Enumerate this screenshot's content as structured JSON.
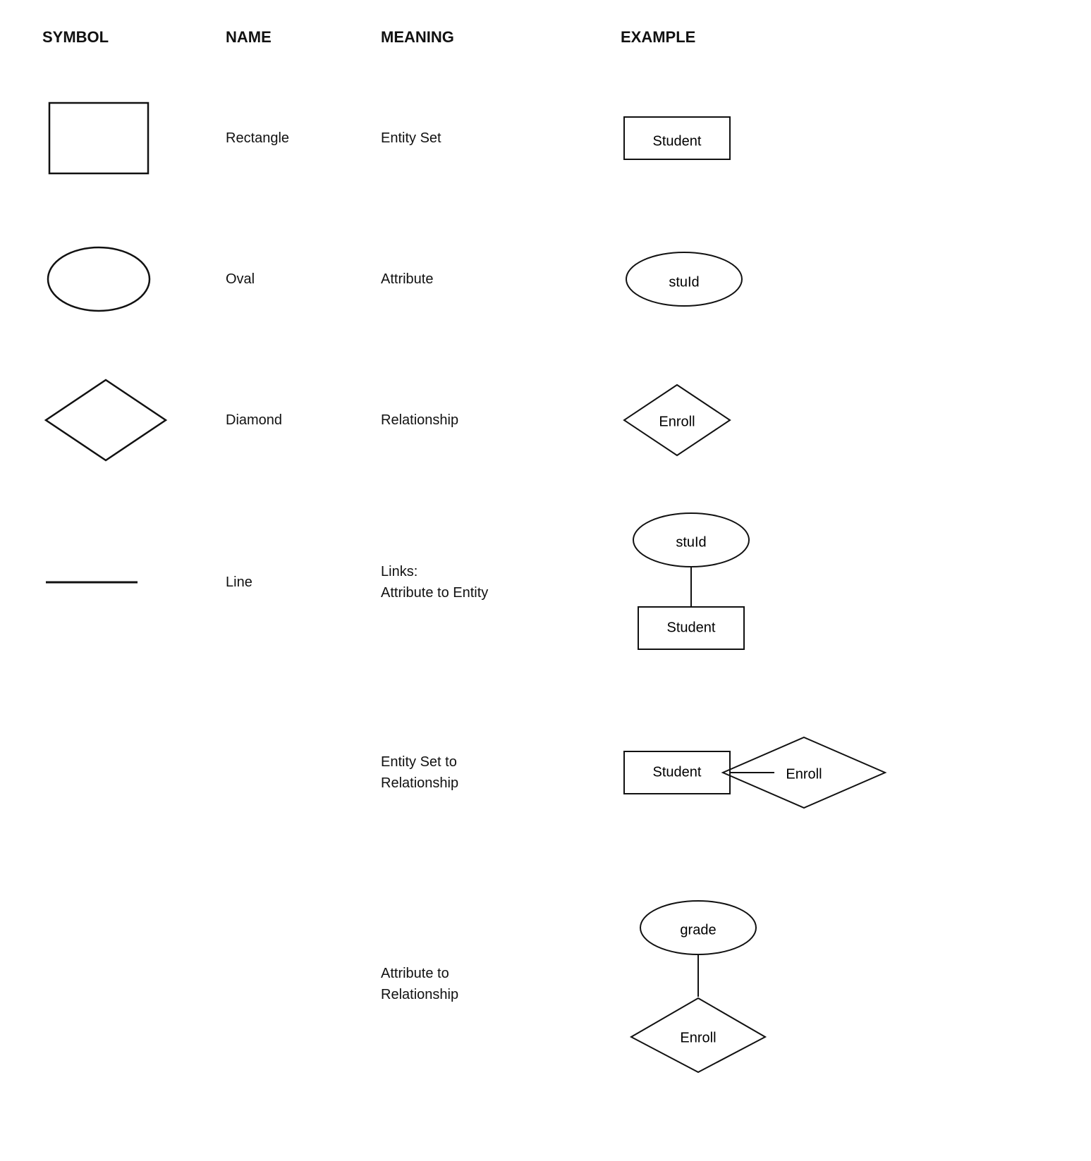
{
  "header": {
    "symbol": "SYMBOL",
    "name": "NAME",
    "meaning": "MEANING",
    "example": "EXAMPLE"
  },
  "rows": [
    {
      "id": "rectangle",
      "name": "Rectangle",
      "meaning": "Entity Set",
      "example_label": "Student"
    },
    {
      "id": "oval",
      "name": "Oval",
      "meaning": "Attribute",
      "example_label": "stuId"
    },
    {
      "id": "diamond",
      "name": "Diamond",
      "meaning": "Relationship",
      "example_label": "Enroll"
    },
    {
      "id": "line",
      "name": "Line",
      "meaning_line1": "Links:",
      "meaning_line2": "Attribute to Entity",
      "example_oval": "stuId",
      "example_rect": "Student"
    }
  ],
  "extra_rows": [
    {
      "id": "entity-set-to-relationship",
      "meaning_line1": "Entity Set to",
      "meaning_line2": "Relationship",
      "example_rect": "Student",
      "example_diamond": "Enroll"
    },
    {
      "id": "attribute-to-relationship",
      "meaning_line1": "Attribute to",
      "meaning_line2": "Relationship",
      "example_oval": "grade",
      "example_diamond": "Enroll"
    }
  ]
}
